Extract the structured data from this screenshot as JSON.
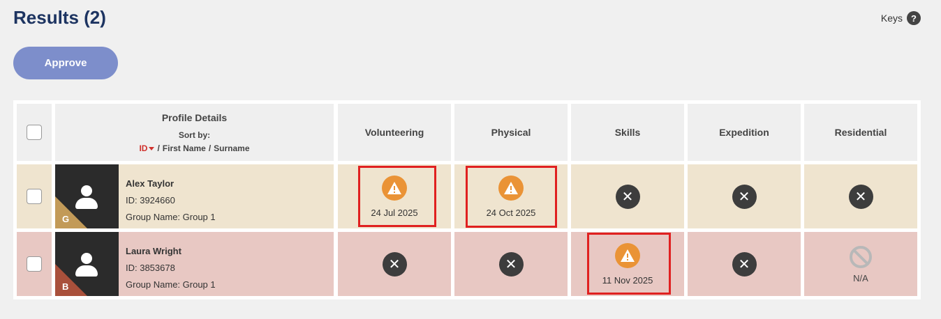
{
  "header": {
    "title": "Results (2)",
    "keys_label": "Keys",
    "help_glyph": "?"
  },
  "toolbar": {
    "approve_label": "Approve"
  },
  "table": {
    "profile_header": {
      "title": "Profile Details",
      "sort_by": "Sort by:",
      "sort_options": [
        "ID",
        "First Name",
        "Surname"
      ],
      "separator": "/"
    },
    "columns": [
      "Volunteering",
      "Physical",
      "Skills",
      "Expedition",
      "Residential"
    ],
    "rows": [
      {
        "name": "Alex Taylor",
        "id": "ID: 3924660",
        "group": "Group Name: Group 1",
        "level": "G",
        "level_color": "#c29a58",
        "cells": [
          {
            "status": "warning-icon",
            "date": "24 Jul 2025"
          },
          {
            "status": "warning-icon",
            "date": "24 Oct 2025"
          },
          {
            "status": "x-circle-icon"
          },
          {
            "status": "x-circle-icon"
          },
          {
            "status": "x-circle-icon"
          }
        ]
      },
      {
        "name": "Laura Wright",
        "id": "ID: 3853678",
        "group": "Group Name: Group 1",
        "level": "B",
        "level_color": "#a9503b",
        "cells": [
          {
            "status": "x-circle-icon"
          },
          {
            "status": "x-circle-icon"
          },
          {
            "status": "warning-icon",
            "date": "11 Nov 2025"
          },
          {
            "status": "x-circle-icon"
          },
          {
            "status": "not-applicable-icon",
            "label": "N/A"
          }
        ]
      }
    ]
  },
  "colors": {
    "title": "#1d3461",
    "approve_button": "#7d8ecb",
    "row1_bg": "#efe4cf",
    "row2_bg": "#e8c8c3",
    "warning": "#ea9336",
    "highlight": "#e02020",
    "sort_active": "#d0312d"
  }
}
